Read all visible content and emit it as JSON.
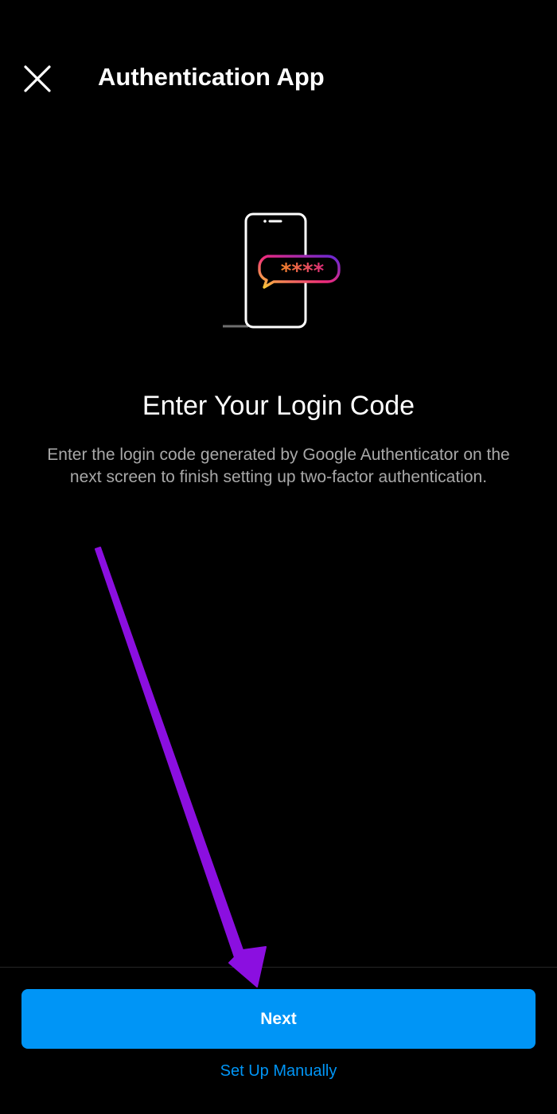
{
  "header": {
    "title": "Authentication App",
    "close_icon": "close-icon"
  },
  "illustration": {
    "icon": "phone-with-code-bubble-icon",
    "code_mask": "****",
    "gradient_colors": [
      "#f9ce34",
      "#ee2a7b",
      "#6228d7"
    ]
  },
  "content": {
    "heading": "Enter Your Login Code",
    "description": "Enter the login code generated by Google Authenticator on the next screen to finish setting up two-factor authentication."
  },
  "footer": {
    "next_label": "Next",
    "manual_label": "Set Up Manually"
  },
  "colors": {
    "background": "#000000",
    "primary": "#0095f6",
    "secondary_text": "#a8a8a8",
    "annotation_arrow": "#8b0fe0"
  }
}
